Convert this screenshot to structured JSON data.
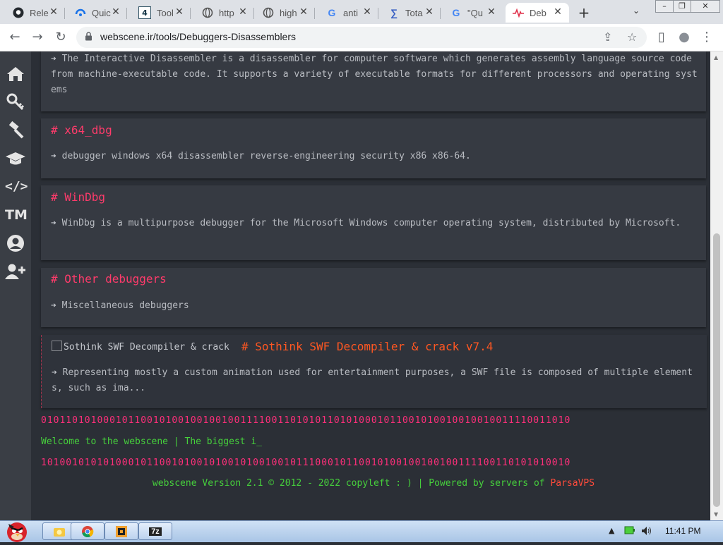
{
  "browser": {
    "tabs": [
      {
        "title": "Rele",
        "icon": "github-icon"
      },
      {
        "title": "Quic",
        "icon": "quickref-icon"
      },
      {
        "title": "Tool",
        "icon": "tool-4-icon"
      },
      {
        "title": "http",
        "icon": "globe-icon"
      },
      {
        "title": "high",
        "icon": "globe-icon"
      },
      {
        "title": "anti",
        "icon": "google-icon"
      },
      {
        "title": "Tota",
        "icon": "virustotal-icon"
      },
      {
        "title": "\"Qu",
        "icon": "google-icon"
      },
      {
        "title": "Deb",
        "icon": "heartbeat-icon"
      }
    ],
    "new_tab": "+",
    "tab_search": "⌄",
    "window_buttons": {
      "minimize": "–",
      "maximize": "❐",
      "close": "✕"
    },
    "address": {
      "url": "webscene.ir/tools/Debuggers-Disassemblers"
    },
    "toolbar_icons": {
      "back": "←",
      "forward": "→",
      "reload": "↻",
      "share": "⇪",
      "star": "☆",
      "sidepanel": "▯",
      "profile": "●",
      "menu": "⋮"
    }
  },
  "sidenav": {
    "items": [
      "home-icon",
      "key-icon",
      "hammer-icon",
      "graduation-cap-icon",
      "code-icon",
      "trademark-icon",
      "user-circle-icon",
      "user-plus-icon"
    ],
    "tm_label": "TM"
  },
  "cards": [
    {
      "title": "",
      "desc": "The Interactive Disassembler is a disassembler for computer software which generates assembly language source code from machine-executable code. It supports a variety of executable formats for different processors and operating systems"
    },
    {
      "title": "# x64_dbg",
      "desc": "debugger windows x64 disassembler reverse-engineering security x86 x86-64."
    },
    {
      "title": "# WinDbg",
      "desc": "WinDbg is a multipurpose debugger for the Microsoft Windows computer operating system, distributed by Microsoft."
    },
    {
      "title": "# Other debuggers",
      "desc": "Miscellaneous debuggers"
    }
  ],
  "featured": {
    "image_alt": "Sothink SWF Decompiler & crack",
    "title": "# Sothink SWF Decompiler & crack v7.4",
    "desc": "Representing mostly a custom animation used for entertainment purposes, a SWF file is composed of multiple elements, such as ima..."
  },
  "ticker": {
    "binary_top": "0101101010001011001010010010010011110011010101101010001011001010010010010011110011010",
    "welcome": "Welcome to the webscene | The biggest i_",
    "binary_bottom": "1010010101010001011001010010100101001001011100010110010100100100100111100110101010010"
  },
  "footer": {
    "text": "webscene Version 2.1 © 2012 - 2022 copyleft : ) | Powered by servers of ",
    "brand": "ParsaVPS"
  },
  "taskbar": {
    "apps": [
      "explorer-icon",
      "chrome-icon",
      "disassembler-icon",
      "7zip-icon"
    ],
    "app_7z_label": "7z",
    "clock": "11:41 PM",
    "tray_show": "▲"
  },
  "colors": {
    "accent_title": "#ff3b6b",
    "featured_title": "#ff5722",
    "green": "#46d03c",
    "binary": "#ff2f7a"
  }
}
